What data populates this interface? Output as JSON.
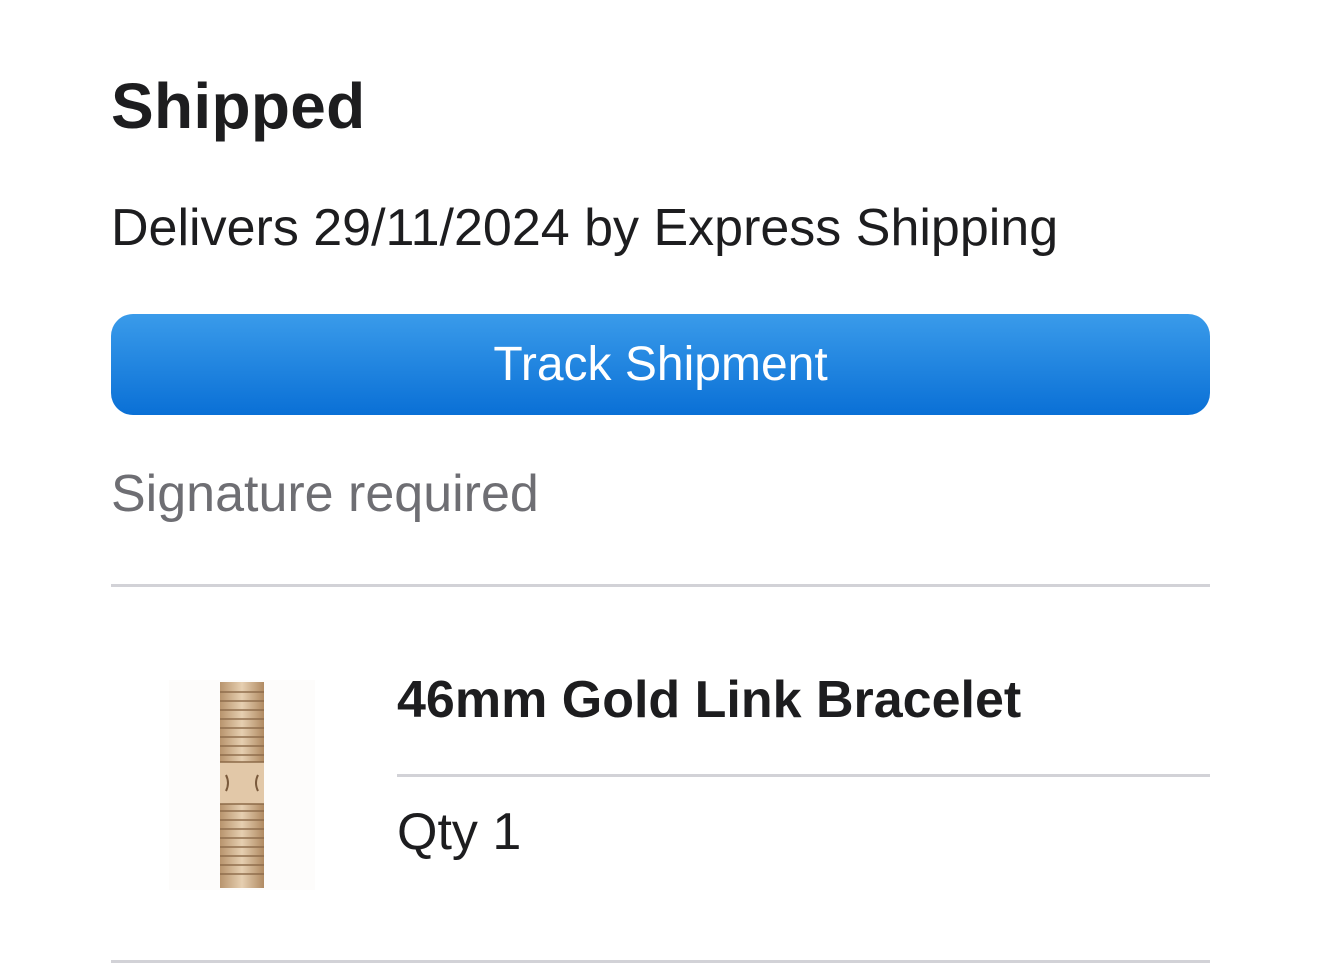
{
  "shipment": {
    "status": "Shipped",
    "delivery": "Delivers 29/11/2024 by Express Shipping",
    "track_button_label": "Track Shipment",
    "signature_note": "Signature required"
  },
  "item": {
    "name": "46mm Gold Link Bracelet",
    "quantity": "Qty 1",
    "image_icon": "gold-link-bracelet-image"
  },
  "colors": {
    "button_top": "#3a9bea",
    "button_bottom": "#0a70d6",
    "secondary_text": "#6e6e73",
    "divider": "#d2d2d7"
  }
}
